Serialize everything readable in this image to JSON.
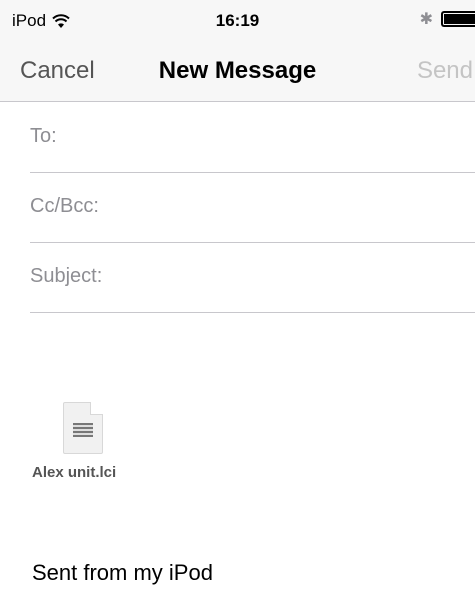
{
  "status_bar": {
    "carrier": "iPod",
    "time": "16:19",
    "icons": [
      "wifi-icon",
      "bluetooth-icon",
      "battery-icon"
    ]
  },
  "nav": {
    "cancel_label": "Cancel",
    "title": "New Message",
    "send_label": "Send"
  },
  "fields": {
    "to_label": "To:",
    "to_value": "",
    "ccbcc_label": "Cc/Bcc:",
    "ccbcc_value": "",
    "subject_label": "Subject:",
    "subject_value": ""
  },
  "attachment": {
    "file_name": "Alex unit.lci",
    "icon": "document-icon"
  },
  "body": {
    "signature": "Sent from my iPod"
  },
  "colors": {
    "bar_background": "#f7f7f7",
    "separator": "#c8c7cc",
    "label_gray": "#8e8e93",
    "disabled_send": "#c4c4c4"
  }
}
